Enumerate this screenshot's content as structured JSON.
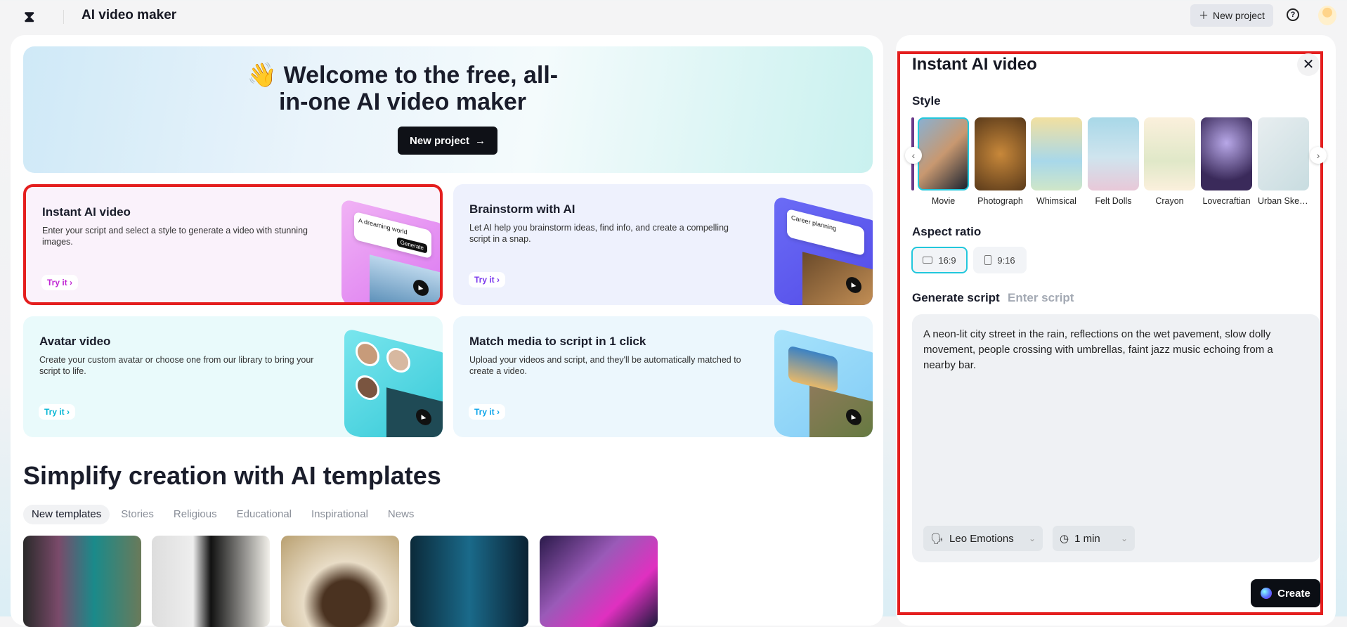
{
  "header": {
    "title": "AI video maker",
    "new_project": "New project",
    "help_icon": "?"
  },
  "hero": {
    "emoji": "👋",
    "title": "Welcome to the free, all-in-one AI video maker",
    "button": "New project"
  },
  "cards": [
    {
      "title": "Instant AI video",
      "desc": "Enter your script and select a style to generate a video with stunning images.",
      "cta": "Try it",
      "art_text": "A dreaming world",
      "art_btn": "Generate",
      "color": "#c026d3"
    },
    {
      "title": "Brainstorm with AI",
      "desc": "Let AI help you brainstorm ideas, find info, and create a compelling script in a snap.",
      "cta": "Try it",
      "art_text": "Career planning",
      "color": "#7c3aed"
    },
    {
      "title": "Avatar video",
      "desc": "Create your custom avatar or choose one from our library to bring your script to life.",
      "cta": "Try it",
      "color": "#06b6d4"
    },
    {
      "title": "Match media to script in 1 click",
      "desc": "Upload your videos and script, and they'll be automatically matched to create a video.",
      "cta": "Try it",
      "color": "#0ea5e9"
    }
  ],
  "templates": {
    "title": "Simplify creation with AI templates",
    "tabs": [
      "New templates",
      "Stories",
      "Religious",
      "Educational",
      "Inspirational",
      "News"
    ]
  },
  "panel": {
    "title": "Instant AI video",
    "style_label": "Style",
    "styles": [
      "Movie",
      "Photograph",
      "Whimsical",
      "Felt Dolls",
      "Crayon",
      "Lovecraftian",
      "Urban Sketch"
    ],
    "aspect_label": "Aspect ratio",
    "aspects": [
      "16:9",
      "9:16"
    ],
    "script_tabs": [
      "Generate script",
      "Enter script"
    ],
    "script": "A neon-lit city street in the rain, reflections on the wet pavement, slow dolly movement, people crossing with umbrellas, faint jazz music echoing from a nearby bar.",
    "voice": "Leo Emotions",
    "duration": "1 min",
    "create": "Create"
  }
}
